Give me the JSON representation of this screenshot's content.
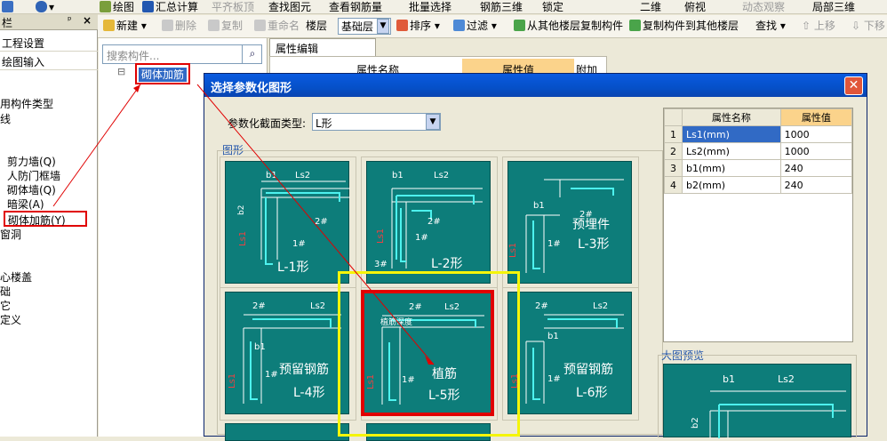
{
  "toolbar1": {
    "items": [
      "绘图",
      "汇总计算",
      "平齐板顶",
      "查找图元",
      "查看钢筋量",
      "批量选择",
      "钢筋三维",
      "锁定",
      "二维",
      "俯视",
      "动态观察",
      "局部三维"
    ]
  },
  "toolbar2": {
    "new": "新建",
    "delete": "删除",
    "copy": "复制",
    "rename": "重命名",
    "floor": "楼层",
    "floor_value": "基础层",
    "sort": "排序",
    "filter": "过滤",
    "copy_from": "从其他楼层复制构件",
    "copy_to": "复制构件到其他楼层",
    "find": "查找",
    "up": "上移",
    "down": "下移"
  },
  "left_panel": {
    "header": "栏",
    "items": [
      "工程设置",
      "绘图输入",
      "用构件类型",
      "线",
      "剪力墙(Q)",
      "人防门框墙",
      "砌体墙(Q)",
      "暗梁(A)",
      "砌体加筋(Y)",
      "窗洞",
      "心楼盖",
      "础",
      "它",
      "定义"
    ]
  },
  "middle_panel": {
    "search_placeholder": "搜索构件...",
    "tree_item": "砌体加筋"
  },
  "property_panel": {
    "tab": "属性编辑",
    "col_name": "属性名称",
    "col_value": "属性值",
    "col_extra": "附加"
  },
  "dialog": {
    "title": "选择参数化图形",
    "section_type_label": "参数化截面类型:",
    "section_type_value": "L形",
    "group_label": "图形",
    "preview_label": "大图预览",
    "table": {
      "col_name": "属性名称",
      "col_value": "属性值",
      "rows": [
        {
          "idx": "1",
          "name": "Ls1(mm)",
          "value": "1000"
        },
        {
          "idx": "2",
          "name": "Ls2(mm)",
          "value": "1000"
        },
        {
          "idx": "3",
          "name": "b1(mm)",
          "value": "240"
        },
        {
          "idx": "4",
          "name": "b2(mm)",
          "value": "240"
        }
      ]
    },
    "shapes": [
      {
        "label": "L-1形",
        "extra": ""
      },
      {
        "label": "L-2形",
        "extra": ""
      },
      {
        "label": "L-3形",
        "extra": "预埋件"
      },
      {
        "label": "L-4形",
        "extra": "预留钢筋"
      },
      {
        "label": "L-5形",
        "extra": "植筋"
      },
      {
        "label": "L-6形",
        "extra": "预留钢筋"
      }
    ],
    "dims": {
      "b1": "b1",
      "b2": "b2",
      "ls1": "Ls1",
      "ls2": "Ls2",
      "bar1": "1#",
      "bar2": "2#",
      "bar3": "3#",
      "embed": "植筋深度"
    }
  },
  "colors": {
    "tile": "#0d7d7a",
    "highlight_red": "#e00000",
    "highlight_yellow": "#f5f50a",
    "accent_header": "#fbd38b"
  }
}
